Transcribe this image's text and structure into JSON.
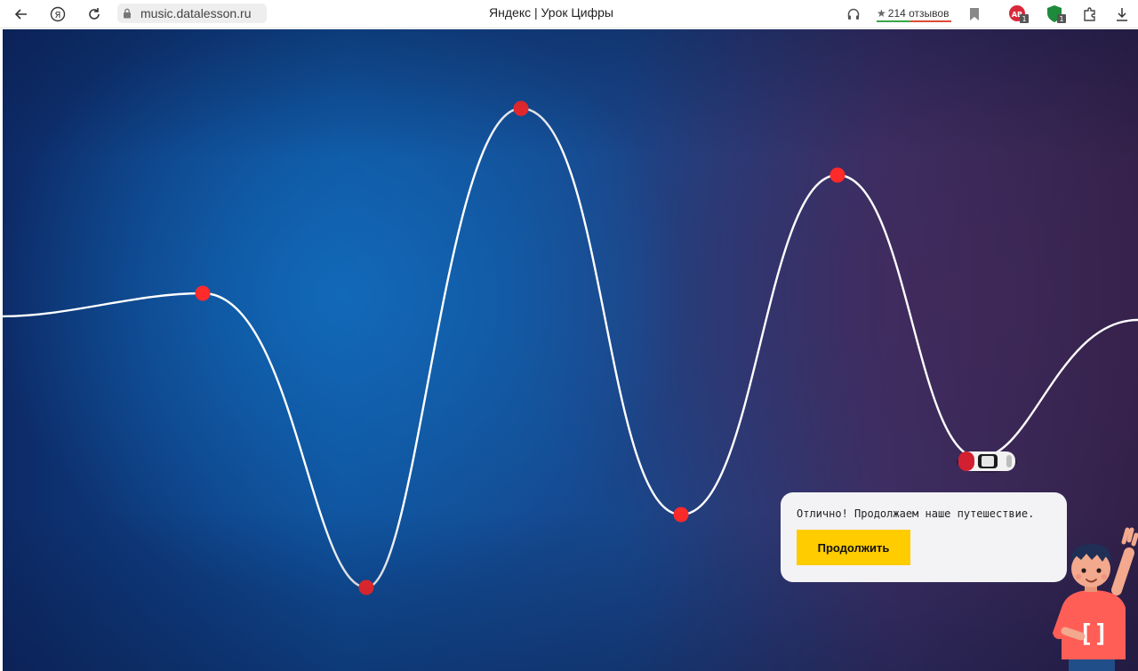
{
  "browser": {
    "url": "music.datalesson.ru",
    "title": "Яндекс | Урок Цифры",
    "reviews_label": "214 отзывов",
    "ad_badge": "1",
    "ext_badge": "1"
  },
  "dialog": {
    "message": "Отлично! Продолжаем наше путешествие.",
    "button_label": "Продолжить"
  },
  "mascot": {
    "shirt_glyph": "[]"
  },
  "colors": {
    "accent_button": "#ffcc00",
    "wave_line": "#ffffff",
    "checkpoint": "#ff2a2a"
  }
}
